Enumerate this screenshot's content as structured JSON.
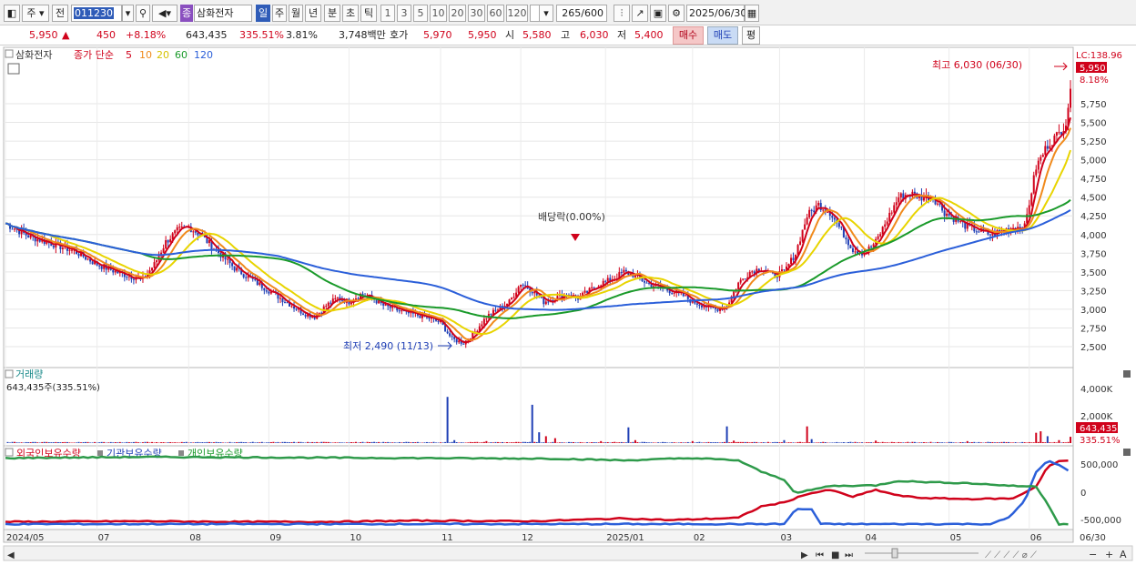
{
  "toolbar": {
    "market": "주",
    "all": "전",
    "code": "011230",
    "stock_badge": "종",
    "stock_name": "삼화전자",
    "periods": [
      "일",
      "주",
      "월",
      "년",
      "분",
      "초",
      "틱"
    ],
    "period_selected": 0,
    "intervals": [
      "1",
      "3",
      "5",
      "10",
      "20",
      "30",
      "60",
      "120"
    ],
    "count": "265",
    "count_max": "/600",
    "date": "2025/06/30"
  },
  "quote": {
    "price": "5,950",
    "change_arrow": "▲",
    "change": "450",
    "change_pct": "+8.18%",
    "volume": "643,435",
    "volume_ratio": "335.51%",
    "turnover_ratio": "3.81%",
    "amount": "3,748백만",
    "ask_label": "호가",
    "ask": "5,970",
    "bid": "5,950",
    "open_label": "시",
    "open": "5,580",
    "high_label": "고",
    "high": "6,030",
    "low_label": "저",
    "low": "5,400",
    "buy_label": "매수",
    "sell_label": "매도",
    "avg_label": "평"
  },
  "price_panel": {
    "stock_name": "삼화전자",
    "legend_prefix": "종가 단순",
    "ma_periods": [
      "5",
      "10",
      "20",
      "60",
      "120"
    ],
    "ma_colors": [
      "#d0021b",
      "#f08a1c",
      "#e8d400",
      "#1a9a2a",
      "#2b5fd9"
    ],
    "lc_label": "LC:138.96",
    "current_price_tag": "5,950",
    "current_pct_tag": "8.18%",
    "high_note": "최고 6,030 (06/30)",
    "low_note": "최저 2,490 (11/13)",
    "dividend_note": "배당락(0.00%)",
    "yticks": [
      "5,750",
      "5,500",
      "5,250",
      "5,000",
      "4,750",
      "4,500",
      "4,250",
      "4,000",
      "3,750",
      "3,500",
      "3,250",
      "3,000",
      "2,750",
      "2,500"
    ]
  },
  "volume_panel": {
    "title": "거래량",
    "value_line": "643,435주(335.51%)",
    "yticks": [
      "4,000K",
      "2,000K"
    ],
    "current_tag": "643,435",
    "current_pct_tag": "335.51%"
  },
  "holding_panel": {
    "legend": [
      "외국인보유수량",
      "기관보유수량",
      "개인보유수량"
    ],
    "legend_colors": [
      "#d0021b",
      "#1f3fb5",
      "#1a9a2a"
    ],
    "yticks": [
      "500,000",
      "0",
      "-500,000"
    ]
  },
  "x_axis": {
    "labels": [
      "2024/05",
      "07",
      "08",
      "09",
      "10",
      "11",
      "12",
      "2025/01",
      "02",
      "03",
      "04",
      "05",
      "06"
    ],
    "end_label": "06/30"
  },
  "chart_data": {
    "type": "candlestick",
    "period_start": "2024/05",
    "period_end": "2025/06/30",
    "summary": {
      "high": 6030,
      "high_date": "06/30",
      "low": 2490,
      "low_date": "11/13",
      "last_close": 5950
    },
    "close_series": [
      [
        0,
        4150
      ],
      [
        10,
        3980
      ],
      [
        20,
        3880
      ],
      [
        30,
        3780
      ],
      [
        40,
        3600
      ],
      [
        50,
        3480
      ],
      [
        60,
        3400
      ],
      [
        65,
        3600
      ],
      [
        70,
        3900
      ],
      [
        75,
        4050
      ],
      [
        80,
        4100
      ],
      [
        85,
        4000
      ],
      [
        90,
        3850
      ],
      [
        95,
        3700
      ],
      [
        100,
        3550
      ],
      [
        105,
        3450
      ],
      [
        110,
        3350
      ],
      [
        115,
        3250
      ],
      [
        120,
        3150
      ],
      [
        125,
        3050
      ],
      [
        130,
        2950
      ],
      [
        135,
        2900
      ],
      [
        140,
        3050
      ],
      [
        145,
        3150
      ],
      [
        150,
        3100
      ],
      [
        155,
        3200
      ],
      [
        160,
        3150
      ],
      [
        165,
        3050
      ],
      [
        170,
        3000
      ],
      [
        175,
        2950
      ],
      [
        180,
        2920
      ],
      [
        185,
        2880
      ],
      [
        190,
        2820
      ],
      [
        195,
        2600
      ],
      [
        200,
        2550
      ],
      [
        205,
        2700
      ],
      [
        210,
        2900
      ],
      [
        215,
        3000
      ],
      [
        220,
        3100
      ],
      [
        225,
        3350
      ],
      [
        230,
        3250
      ],
      [
        235,
        3100
      ],
      [
        240,
        3150
      ],
      [
        245,
        3200
      ],
      [
        250,
        3150
      ],
      [
        255,
        3250
      ],
      [
        260,
        3350
      ],
      [
        265,
        3400
      ],
      [
        270,
        3500
      ],
      [
        275,
        3450
      ],
      [
        280,
        3350
      ],
      [
        285,
        3300
      ],
      [
        290,
        3250
      ],
      [
        295,
        3200
      ],
      [
        300,
        3100
      ],
      [
        305,
        3050
      ],
      [
        310,
        3000
      ],
      [
        315,
        3050
      ],
      [
        320,
        3350
      ],
      [
        325,
        3500
      ],
      [
        330,
        3550
      ],
      [
        335,
        3450
      ],
      [
        340,
        3500
      ],
      [
        345,
        3750
      ],
      [
        350,
        4250
      ],
      [
        355,
        4400
      ],
      [
        360,
        4300
      ],
      [
        365,
        4050
      ],
      [
        370,
        3800
      ],
      [
        375,
        3750
      ],
      [
        380,
        3900
      ],
      [
        385,
        4200
      ],
      [
        390,
        4500
      ],
      [
        395,
        4550
      ],
      [
        400,
        4500
      ],
      [
        405,
        4500
      ],
      [
        410,
        4300
      ],
      [
        415,
        4200
      ],
      [
        420,
        4100
      ],
      [
        425,
        4050
      ],
      [
        430,
        4000
      ],
      [
        435,
        4050
      ],
      [
        440,
        4100
      ],
      [
        445,
        4100
      ],
      [
        450,
        4900
      ],
      [
        455,
        5200
      ],
      [
        460,
        5350
      ],
      [
        463,
        5500
      ],
      [
        465,
        5950
      ]
    ],
    "volume_k": [
      [
        0,
        60
      ],
      [
        25,
        90
      ],
      [
        60,
        80
      ],
      [
        90,
        70
      ],
      [
        120,
        50
      ],
      [
        150,
        60
      ],
      [
        190,
        70
      ],
      [
        193,
        4700
      ],
      [
        196,
        300
      ],
      [
        210,
        200
      ],
      [
        230,
        3900
      ],
      [
        233,
        1100
      ],
      [
        236,
        700
      ],
      [
        240,
        500
      ],
      [
        260,
        200
      ],
      [
        272,
        1600
      ],
      [
        275,
        300
      ],
      [
        300,
        200
      ],
      [
        315,
        1700
      ],
      [
        318,
        250
      ],
      [
        340,
        300
      ],
      [
        350,
        1700
      ],
      [
        352,
        400
      ],
      [
        380,
        250
      ],
      [
        420,
        200
      ],
      [
        450,
        1050
      ],
      [
        452,
        1200
      ],
      [
        455,
        700
      ],
      [
        460,
        300
      ],
      [
        465,
        643
      ]
    ],
    "holdings_foreign": [
      [
        0,
        -520000
      ],
      [
        60,
        -510000
      ],
      [
        100,
        -520000
      ],
      [
        140,
        -520000
      ],
      [
        180,
        -500000
      ],
      [
        230,
        -510000
      ],
      [
        270,
        -460000
      ],
      [
        290,
        -490000
      ],
      [
        320,
        -450000
      ],
      [
        330,
        -250000
      ],
      [
        340,
        -180000
      ],
      [
        350,
        -30000
      ],
      [
        360,
        40000
      ],
      [
        370,
        -80000
      ],
      [
        380,
        40000
      ],
      [
        390,
        -60000
      ],
      [
        400,
        -100000
      ],
      [
        420,
        -120000
      ],
      [
        440,
        -110000
      ],
      [
        450,
        100000
      ],
      [
        455,
        450000
      ],
      [
        460,
        540000
      ],
      [
        465,
        560000
      ]
    ],
    "holdings_institution": [
      [
        0,
        -560000
      ],
      [
        100,
        -560000
      ],
      [
        200,
        -560000
      ],
      [
        300,
        -560000
      ],
      [
        340,
        -560000
      ],
      [
        345,
        -300000
      ],
      [
        352,
        -300000
      ],
      [
        356,
        -560000
      ],
      [
        430,
        -560000
      ],
      [
        438,
        -450000
      ],
      [
        445,
        -150000
      ],
      [
        450,
        350000
      ],
      [
        455,
        550000
      ],
      [
        460,
        480000
      ],
      [
        465,
        350000
      ]
    ],
    "holdings_individual": [
      [
        0,
        600000
      ],
      [
        60,
        620000
      ],
      [
        120,
        610000
      ],
      [
        180,
        600000
      ],
      [
        240,
        590000
      ],
      [
        270,
        560000
      ],
      [
        300,
        600000
      ],
      [
        320,
        560000
      ],
      [
        330,
        360000
      ],
      [
        340,
        220000
      ],
      [
        345,
        -20000
      ],
      [
        360,
        110000
      ],
      [
        380,
        120000
      ],
      [
        390,
        200000
      ],
      [
        400,
        180000
      ],
      [
        420,
        160000
      ],
      [
        440,
        110000
      ],
      [
        450,
        100000
      ],
      [
        455,
        -200000
      ],
      [
        460,
        -560000
      ],
      [
        465,
        -560000
      ]
    ]
  }
}
